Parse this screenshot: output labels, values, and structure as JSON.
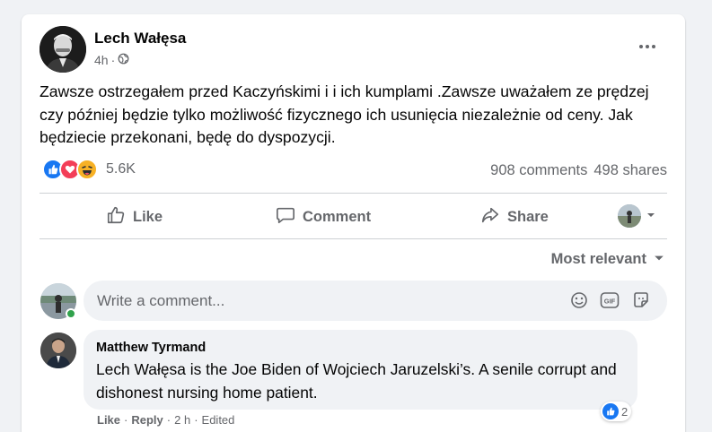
{
  "post": {
    "author": "Lech Wałęsa",
    "time": "4h",
    "separator": "·",
    "audience_icon": "globe-icon",
    "more_icon": "ellipsis-icon",
    "text": "Zawsze ostrzegałem przed Kaczyńskimi i i ich kumplami .Zawsze uważałem ze prędzej czy później będzie tylko możliwość fizycznego ich usunięcia niezależnie od ceny. Jak będziecie przekonani, będę do dyspozycji.",
    "reaction_types": [
      "like",
      "love",
      "haha"
    ],
    "reaction_count": "5.6K",
    "comments_count": "908 comments",
    "shares_count": "498 shares"
  },
  "actions": {
    "like_label": "Like",
    "comment_label": "Comment",
    "share_label": "Share"
  },
  "sort": {
    "label": "Most relevant"
  },
  "composer": {
    "placeholder": "Write a comment...",
    "icons": [
      "emoji-icon",
      "gif-icon",
      "sticker-icon"
    ]
  },
  "comments": [
    {
      "author": "Matthew Tyrmand",
      "text": "Lech Wałęsa is the Joe Biden of Wojciech Jaruzelski’s. A senile corrupt and dishonest nursing home patient.",
      "like_label": "Like",
      "reply_label": "Reply",
      "time": "2 h",
      "edited_label": "Edited",
      "reaction_count": "2"
    }
  ],
  "colors": {
    "accent": "#1877f2",
    "secondary_text": "#65676b",
    "love": "#f33e58",
    "haha": "#f7b125",
    "online": "#31a24c"
  }
}
